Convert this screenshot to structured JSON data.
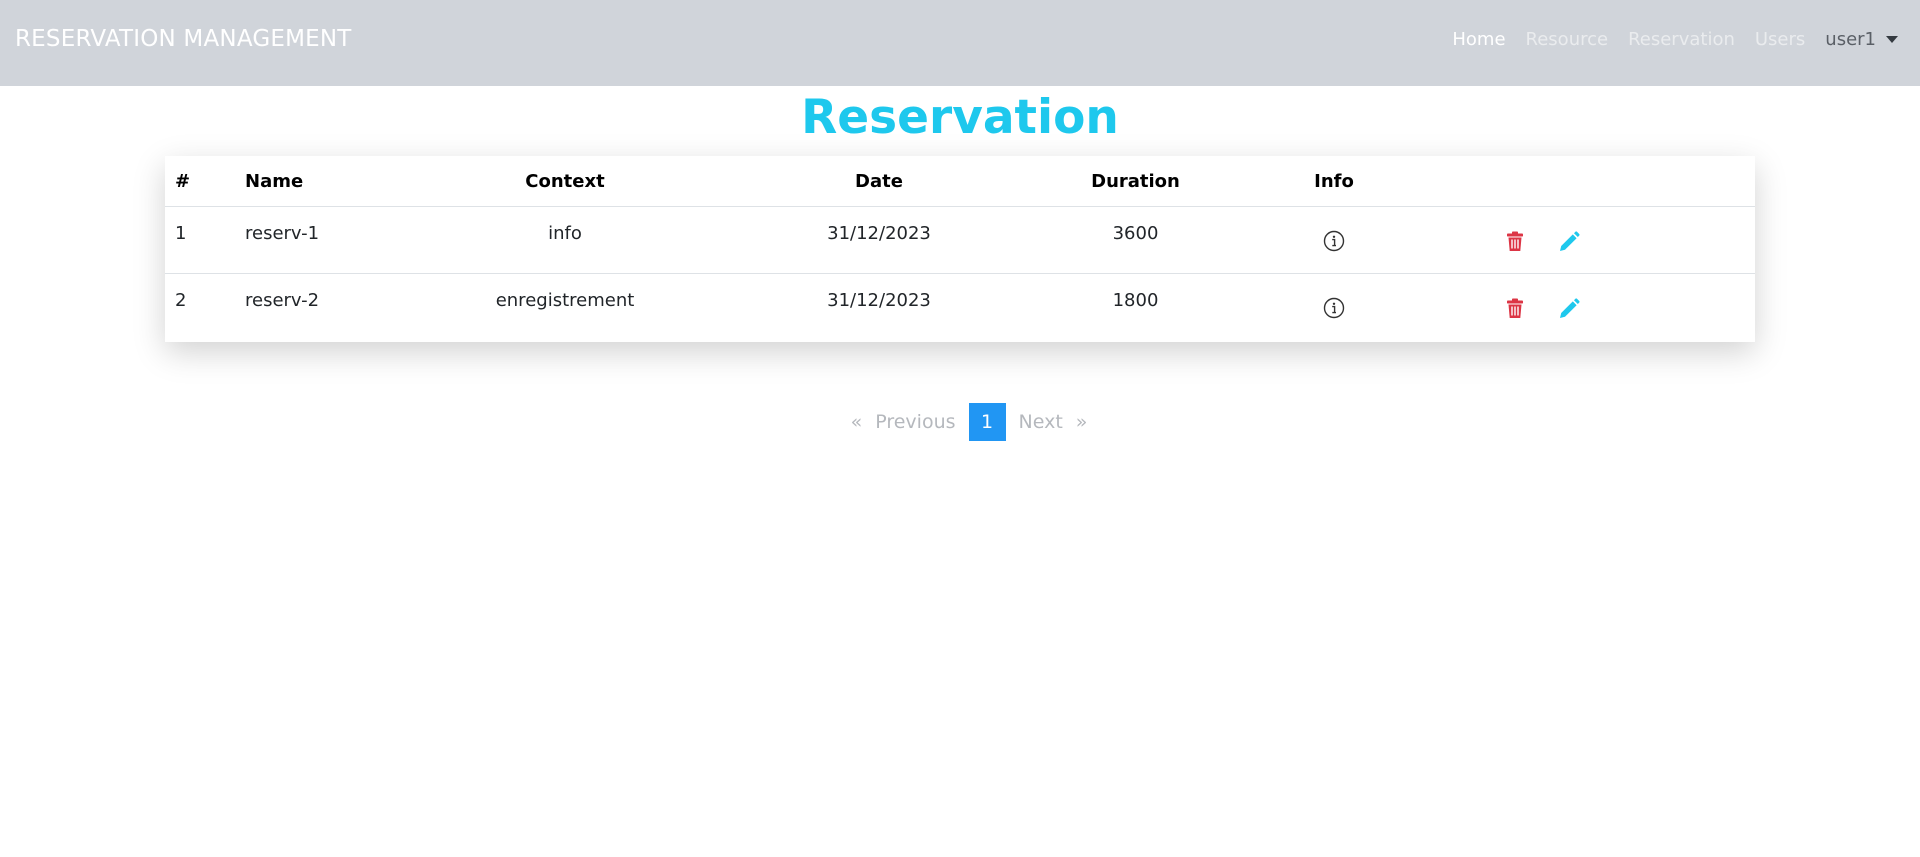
{
  "navbar": {
    "brand": "RESERVATION MANAGEMENT",
    "links": [
      {
        "label": "Home"
      },
      {
        "label": "Resource"
      },
      {
        "label": "Reservation"
      },
      {
        "label": "Users"
      }
    ],
    "user": "user1"
  },
  "page": {
    "title": "Reservation"
  },
  "table": {
    "headers": [
      "#",
      "Name",
      "Context",
      "Date",
      "Duration",
      "Info"
    ],
    "rows": [
      {
        "num": "1",
        "name": "reserv-1",
        "context": "info",
        "date": "31/12/2023",
        "duration": "3600"
      },
      {
        "num": "2",
        "name": "reserv-2",
        "context": "enregistrement",
        "date": "31/12/2023",
        "duration": "1800"
      }
    ]
  },
  "pagination": {
    "prev_arrow": "«",
    "prev_label": "Previous",
    "current": "1",
    "next_label": "Next",
    "next_arrow": "»"
  },
  "icons": {
    "info": "info-circle-icon",
    "delete": "trash-icon",
    "edit": "pencil-icon"
  },
  "colors": {
    "navbar_bg": "#d0d4da",
    "title": "#1ec8ed",
    "delete": "#dc3545",
    "edit": "#1ec8ed",
    "page_active": "#2196f3"
  }
}
